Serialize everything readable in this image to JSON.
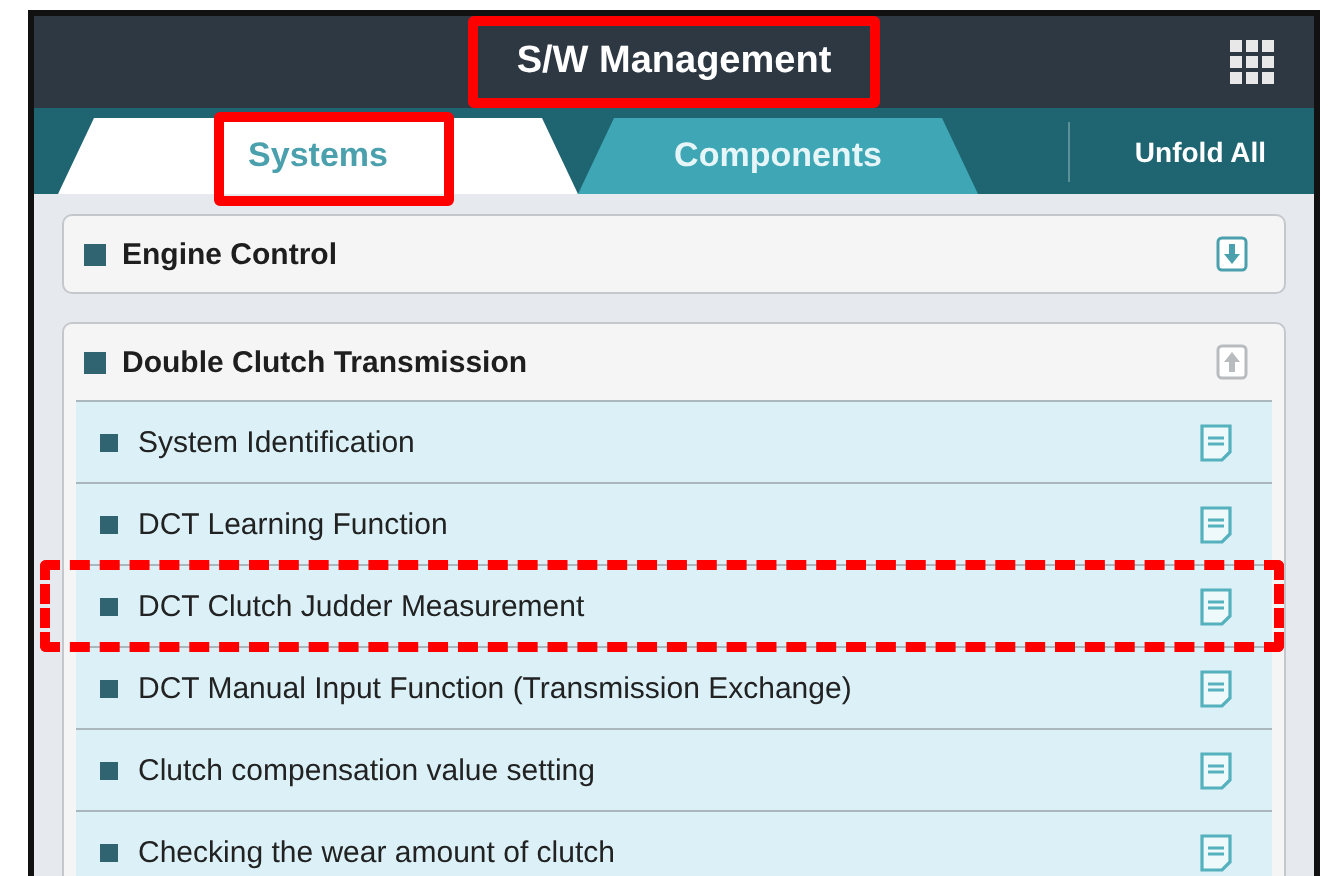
{
  "header": {
    "title": "S/W Management",
    "highlighted": true
  },
  "tabs": [
    {
      "label": "Systems",
      "selected": true,
      "highlighted": true
    },
    {
      "label": "Components",
      "selected": false
    }
  ],
  "unfold_button": "Unfold All",
  "groups": [
    {
      "name": "Engine Control",
      "expanded": false
    },
    {
      "name": "Double Clutch Transmission",
      "expanded": true,
      "items": [
        {
          "label": "System Identification"
        },
        {
          "label": "DCT Learning Function"
        },
        {
          "label": "DCT Clutch Judder Measurement",
          "highlighted": true,
          "dashed": true
        },
        {
          "label": "DCT Manual Input Function (Transmission Exchange)"
        },
        {
          "label": "Clutch compensation value setting"
        },
        {
          "label": "Checking the wear amount of clutch"
        }
      ]
    }
  ]
}
